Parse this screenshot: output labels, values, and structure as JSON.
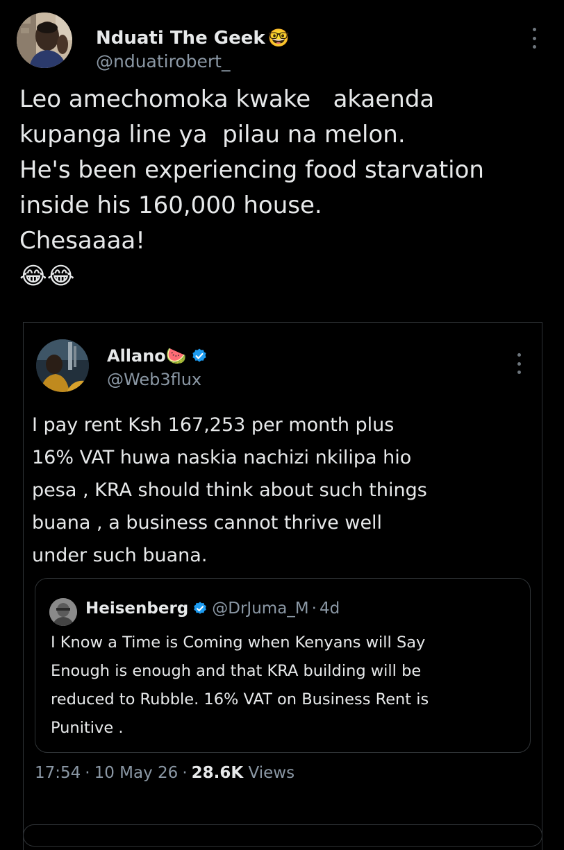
{
  "tweet": {
    "display_name": "Nduati The Geek",
    "name_emoji": "🤓",
    "handle": "@nduatirobert_",
    "text": "Leo amechomoka kwake   akaenda\nkupanga line ya  pilau na melon.\nHe's been experiencing food starvation\ninside his 160,000 house.\nChesaaaa!\n😂😂"
  },
  "quoted": {
    "display_name": "Allano🍉",
    "handle": "@Web3flux",
    "text": "I pay rent Ksh 167,253 per month plus\n16% VAT huwa naskia nachizi nkilipa hio\npesa , KRA should think about such things\nbuana , a business cannot thrive well\nunder such buana.",
    "nested": {
      "display_name": "Heisenberg",
      "handle": "@DrJuma_M",
      "separator": "·",
      "age": "4d",
      "text": "I Know a Time is Coming when Kenyans will Say\nEnough is enough and that KRA building will be\nreduced to Rubble. 16% VAT on Business Rent is\nPunitive ."
    },
    "meta": {
      "time": "17:54",
      "date": "10 May 26",
      "separator": "·",
      "views_count": "28.6K",
      "views_label": "Views"
    }
  },
  "icons": {
    "more": "more-vertical-icon",
    "verified": "verified-badge-icon"
  },
  "colors": {
    "background": "#000000",
    "text_primary": "#e7e9ea",
    "text_secondary": "#8b98a5",
    "border": "#2f3336",
    "verified": "#1d9bf0"
  }
}
